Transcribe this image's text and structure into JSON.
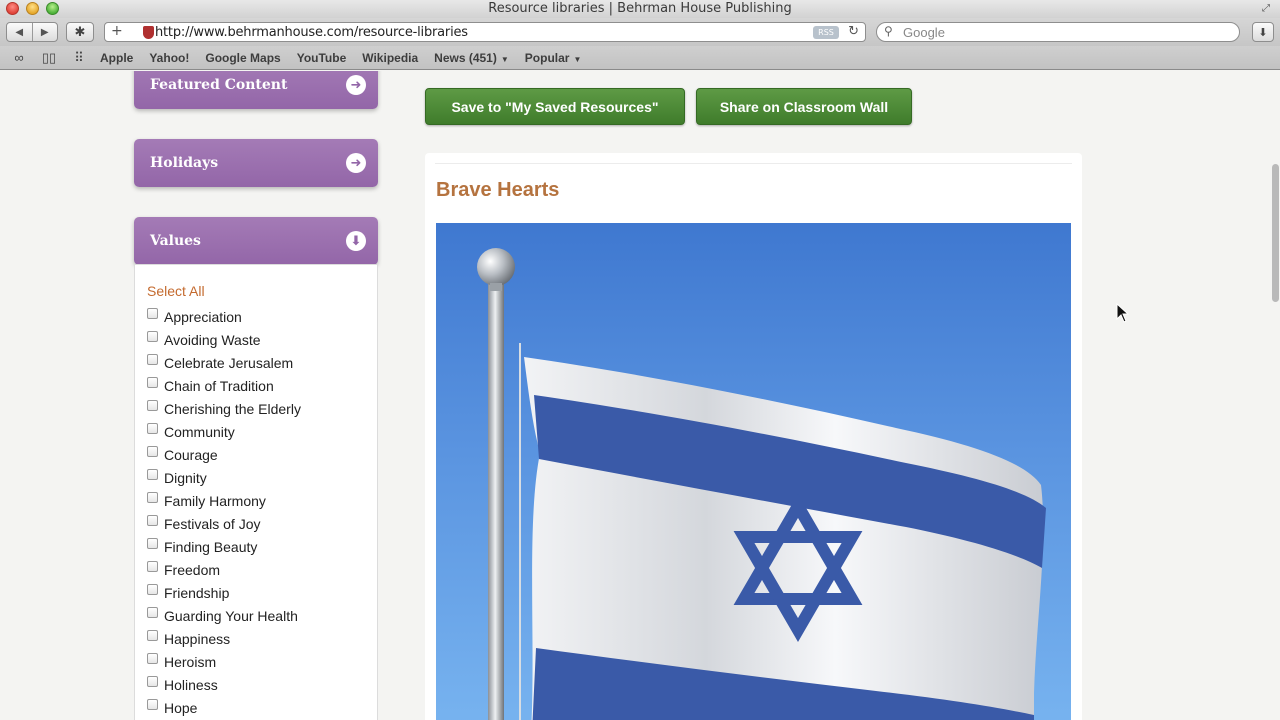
{
  "window": {
    "title": "Resource libraries | Behrman House Publishing"
  },
  "toolbar": {
    "url": "http://www.behrmanhouse.com/resource-libraries",
    "rss_label": "RSS",
    "search_placeholder": "Google"
  },
  "bookmarks": [
    {
      "label": "Apple",
      "has_menu": false
    },
    {
      "label": "Yahoo!",
      "has_menu": false
    },
    {
      "label": "Google Maps",
      "has_menu": false
    },
    {
      "label": "YouTube",
      "has_menu": false
    },
    {
      "label": "Wikipedia",
      "has_menu": false
    },
    {
      "label": "News (451)",
      "has_menu": true
    },
    {
      "label": "Popular",
      "has_menu": true
    }
  ],
  "sidebar": {
    "tabs": [
      {
        "label": "Featured Content",
        "icon": "arrow-right-circle-icon"
      },
      {
        "label": "Holidays",
        "icon": "arrow-right-circle-icon"
      },
      {
        "label": "Values",
        "icon": "arrow-down-circle-icon"
      }
    ],
    "select_all": "Select All",
    "values": [
      "Appreciation",
      "Avoiding Waste",
      "Celebrate Jerusalem",
      "Chain of Tradition",
      "Cherishing the Elderly",
      "Community",
      "Courage",
      "Dignity",
      "Family Harmony",
      "Festivals of Joy",
      "Finding Beauty",
      "Freedom",
      "Friendship",
      "Guarding Your Health",
      "Happiness",
      "Heroism",
      "Holiness",
      "Hope"
    ]
  },
  "actions": {
    "save_label": "Save to \"My Saved Resources\"",
    "share_label": "Share on Classroom Wall"
  },
  "content": {
    "title": "Brave Hearts",
    "image_subject": "israeli-flag",
    "colors": {
      "accent_purple": "#9366a8",
      "button_green": "#4a8634",
      "title_brown": "#b5733f",
      "select_all_orange": "#c46a2e",
      "flag_blue": "#3a5aa8"
    }
  }
}
